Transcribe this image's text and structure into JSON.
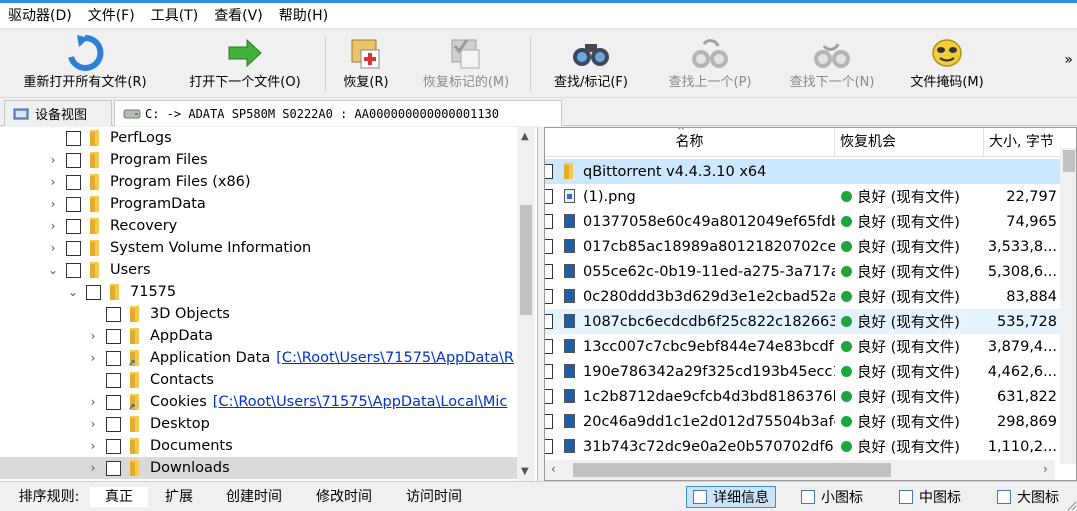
{
  "menu": [
    "驱动器(D)",
    "文件(F)",
    "工具(T)",
    "查看(V)",
    "帮助(H)"
  ],
  "toolbar": {
    "reopen": "重新打开所有文件(R)",
    "open_next": "打开下一个文件(O)",
    "recover": "恢复(R)",
    "recover_marked": "恢复标记的(M)",
    "find_mark": "查找/标记(F)",
    "find_prev": "查找上一个(P)",
    "find_next": "查找下一个(N)",
    "file_mask": "文件掩码(M)",
    "more": "»"
  },
  "tabs": {
    "device_view": "设备视图",
    "drive_path": "C: -> ADATA SP580M S0222A0 : AA000000000000001130"
  },
  "tree": [
    {
      "label": "PerfLogs",
      "indent": 0,
      "arrow": "",
      "link": ""
    },
    {
      "label": "Program Files",
      "indent": 0,
      "arrow": "›",
      "link": ""
    },
    {
      "label": "Program Files (x86)",
      "indent": 0,
      "arrow": "›",
      "link": ""
    },
    {
      "label": "ProgramData",
      "indent": 0,
      "arrow": "›",
      "link": ""
    },
    {
      "label": "Recovery",
      "indent": 0,
      "arrow": "›",
      "link": ""
    },
    {
      "label": "System Volume Information",
      "indent": 0,
      "arrow": "›",
      "link": ""
    },
    {
      "label": "Users",
      "indent": 0,
      "arrow": "⌄",
      "link": ""
    },
    {
      "label": "71575",
      "indent": 1,
      "arrow": "⌄",
      "link": ""
    },
    {
      "label": "3D Objects",
      "indent": 2,
      "arrow": "",
      "link": ""
    },
    {
      "label": "AppData",
      "indent": 2,
      "arrow": "›",
      "link": ""
    },
    {
      "label": "Application Data",
      "indent": 2,
      "arrow": "›",
      "link": "[C:\\Root\\Users\\71575\\AppData\\R"
    },
    {
      "label": "Contacts",
      "indent": 2,
      "arrow": "",
      "link": ""
    },
    {
      "label": "Cookies",
      "indent": 2,
      "arrow": "›",
      "link": "[C:\\Root\\Users\\71575\\AppData\\Local\\Mic"
    },
    {
      "label": "Desktop",
      "indent": 2,
      "arrow": "›",
      "link": ""
    },
    {
      "label": "Documents",
      "indent": 2,
      "arrow": "›",
      "link": ""
    },
    {
      "label": "Downloads",
      "indent": 2,
      "arrow": "›",
      "link": ""
    }
  ],
  "file_list": {
    "columns": [
      "名称",
      "恢复机会",
      "大小, 字节"
    ],
    "folder_row": "qBittorrent v4.4.3.10 x64",
    "rows": [
      {
        "name": "(1).png",
        "status": "良好 (现有文件)",
        "size": "22,797"
      },
      {
        "name": "01377058e60c49a8012049ef65fdb",
        "status": "良好 (现有文件)",
        "size": "74,965"
      },
      {
        "name": "017cb85ac18989a80121820702cec",
        "status": "良好 (现有文件)",
        "size": "3,533,8..."
      },
      {
        "name": "055ce62c-0b19-11ed-a275-3a717a",
        "status": "良好 (现有文件)",
        "size": "5,308,6..."
      },
      {
        "name": "0c280ddd3b3d629d3e1e2cbad52a",
        "status": "良好 (现有文件)",
        "size": "83,884"
      },
      {
        "name": "1087cbc6ecdcdb6f25c822c182663",
        "status": "良好 (现有文件)",
        "size": "535,728"
      },
      {
        "name": "13cc007c7cbc9ebf844e74e83bcdf",
        "status": "良好 (现有文件)",
        "size": "3,879,4..."
      },
      {
        "name": "190e786342a29f325cd193b45ecc1",
        "status": "良好 (现有文件)",
        "size": "4,462,6..."
      },
      {
        "name": "1c2b8712dae9cfcb4d3bd8186376l",
        "status": "良好 (现有文件)",
        "size": "631,822"
      },
      {
        "name": "20c46a9dd1c1e2d012d75504b3afe",
        "status": "良好 (现有文件)",
        "size": "298,869"
      },
      {
        "name": "31b743c72dc9e0a2e0b570702df6",
        "status": "良好 (现有文件)",
        "size": "1,110,2..."
      }
    ]
  },
  "status_bar": {
    "sort_label": "排序规则:",
    "sort_options": [
      "真正",
      "扩展",
      "创建时间",
      "修改时间",
      "访问时间"
    ],
    "views": [
      "详细信息",
      "小图标",
      "中图标",
      "大图标"
    ]
  },
  "colors": {
    "accent": "#2b8ee0",
    "status_good": "#1da63c",
    "selection": "#cce8ff"
  }
}
